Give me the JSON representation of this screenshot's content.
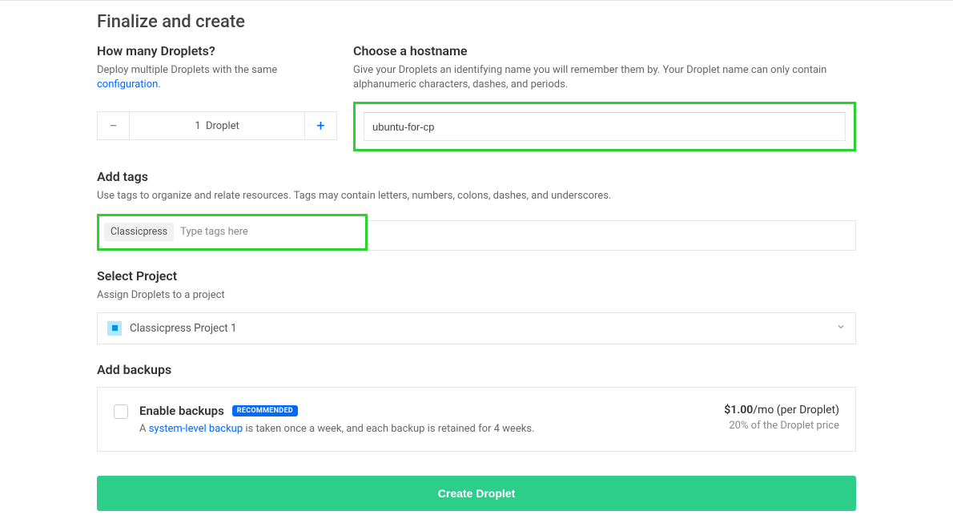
{
  "page": {
    "title": "Finalize and create"
  },
  "droplets": {
    "title": "How many Droplets?",
    "desc_prefix": "Deploy multiple Droplets with the same ",
    "desc_link": "configuration",
    "desc_suffix": ".",
    "count": 1,
    "unit": "Droplet"
  },
  "hostname": {
    "title": "Choose a hostname",
    "desc": "Give your Droplets an identifying name you will remember them by. Your Droplet name can only contain alphanumeric characters, dashes, and periods.",
    "value": "ubuntu-for-cp"
  },
  "tags": {
    "title": "Add tags",
    "desc": "Use tags to organize and relate resources. Tags may contain letters, numbers, colons, dashes, and underscores.",
    "chip": "Classicpress",
    "placeholder": "Type tags here"
  },
  "project": {
    "title": "Select Project",
    "desc": "Assign Droplets to a project",
    "selected": "Classicpress Project 1"
  },
  "backups": {
    "title": "Add backups",
    "enable_label": "Enable backups",
    "badge": "RECOMMENDED",
    "desc_prefix": "A ",
    "desc_link": "system-level backup",
    "desc_suffix": " is taken once a week, and each backup is retained for 4 weeks.",
    "price_amount": "$1.00",
    "price_unit": "/mo (per Droplet)",
    "price_sub": "20% of the Droplet price"
  },
  "submit": {
    "label": "Create Droplet"
  }
}
